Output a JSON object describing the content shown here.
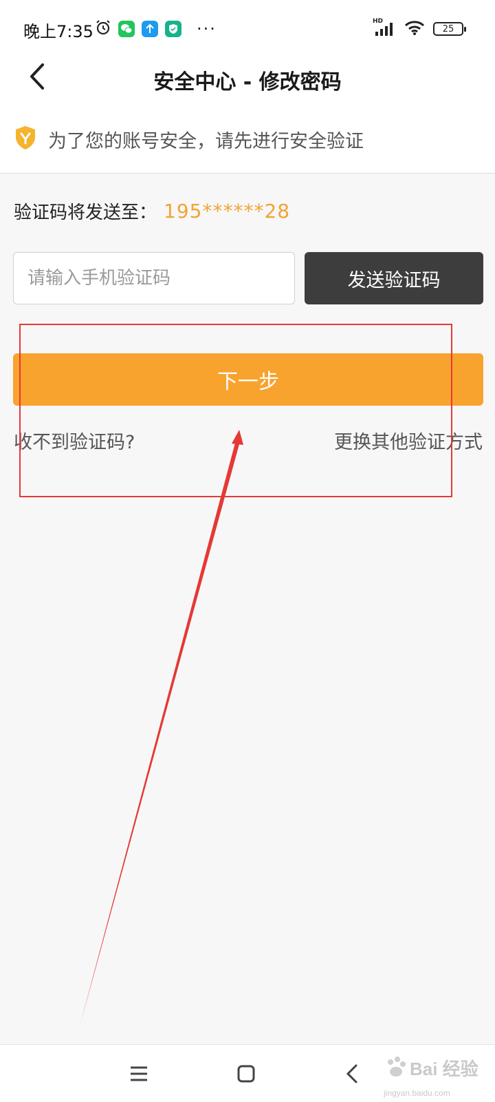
{
  "status_bar": {
    "time": "晚上7:35",
    "signal": "HD",
    "battery": "25",
    "more": "···"
  },
  "header": {
    "title": "安全中心 - 修改密码"
  },
  "notice": {
    "text": "为了您的账号安全，请先进行安全验证",
    "icon": "shield-icon",
    "icon_color": "#f5b32e"
  },
  "verify": {
    "send_to_label": "验证码将发送至：",
    "phone_masked": "195******28",
    "code_placeholder": "请输入手机验证码",
    "code_value": "",
    "send_button": "发送验证码",
    "next_button": "下一步",
    "no_code_link": "收不到验证码?",
    "other_method_link": "更换其他验证方式"
  },
  "colors": {
    "accent": "#f8a32e",
    "phone": "#f2a332",
    "send_button_bg": "#3d3d3d",
    "annotation": "#e53935"
  },
  "watermark": {
    "brand": "Bai 经验",
    "url": "jingyan.baidu.com"
  }
}
